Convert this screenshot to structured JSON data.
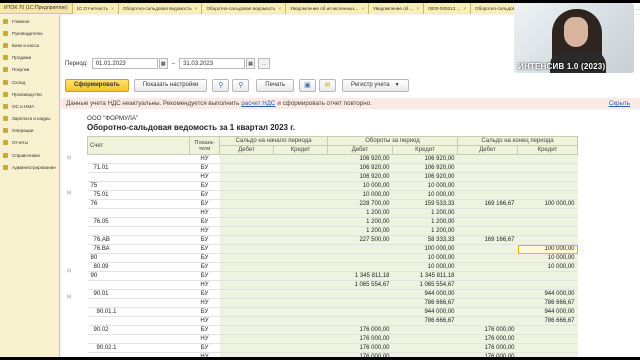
{
  "app": {
    "title": "ИТОК 70 (1С:Предприятие)"
  },
  "open_tabs": [
    "1С:Отчетность",
    "Оборотно-сальдовая ведомость",
    "Оборотно-сальдовая ведомость",
    "Уведомление об исчисленных...",
    "Уведомление об ...",
    "0000-000013 ...",
    "Оборотно-сальдовая ...",
    "Все начисления",
    "Оборотно-сальдовая ..."
  ],
  "sidebar": {
    "items": [
      {
        "label": "Главное",
        "icon": "home-icon"
      },
      {
        "label": "Руководителю",
        "icon": "chart-icon"
      },
      {
        "label": "Банк и касса",
        "icon": "bank-icon"
      },
      {
        "label": "Продажи",
        "icon": "cart-icon"
      },
      {
        "label": "Покупки",
        "icon": "bag-icon"
      },
      {
        "label": "Склад",
        "icon": "warehouse-icon"
      },
      {
        "label": "Производство",
        "icon": "factory-icon"
      },
      {
        "label": "ОС и НМА",
        "icon": "assets-icon"
      },
      {
        "label": "Зарплата и кадры",
        "icon": "people-icon"
      },
      {
        "label": "Операции",
        "icon": "operations-icon"
      },
      {
        "label": "Отчеты",
        "icon": "reports-icon"
      },
      {
        "label": "Справочники",
        "icon": "book-icon"
      },
      {
        "label": "Администрирование",
        "icon": "gear-icon"
      }
    ]
  },
  "document": {
    "title": "Оборотно-сальдовая ведомость за 1 квартал 2023 г."
  },
  "period": {
    "label": "Период:",
    "from": "01.01.2023",
    "separator": "–",
    "to": "31.03.2023",
    "more": "..."
  },
  "toolbar": {
    "generate": "Сформировать",
    "settings": "Показать настройки",
    "print": "Печать",
    "register": "Регистр учета"
  },
  "notice": {
    "text_before": "Данные учета НДС неактуальны. Рекомендуется выполнить",
    "link": "расчет НДС",
    "text_after": "и сформировать отчет повторно.",
    "hide": "Скрыть"
  },
  "report": {
    "organization": "ООО \"ФОРМУЛА\"",
    "title": "Оборотно-сальдовая ведомость за 1 квартал 2023 г.",
    "headers": {
      "account": "Счет",
      "indicators": "Показа-тели",
      "opening": "Сальдо на начало периода",
      "turnover": "Обороты за период",
      "closing": "Сальдо на конец периода",
      "debit": "Дебет",
      "credit": "Кредит"
    },
    "rows": [
      {
        "account": "",
        "type": "НУ",
        "od": "",
        "oc": "",
        "td": "106 920,00",
        "tc": "106 920,00",
        "cd": "",
        "cc": ""
      },
      {
        "account": "71.01",
        "type": "БУ",
        "od": "",
        "oc": "",
        "td": "106 920,00",
        "tc": "106 920,00",
        "cd": "",
        "cc": ""
      },
      {
        "account": "",
        "type": "НУ",
        "od": "",
        "oc": "",
        "td": "106 920,00",
        "tc": "106 920,00",
        "cd": "",
        "cc": ""
      },
      {
        "account": "75",
        "type": "БУ",
        "od": "",
        "oc": "",
        "td": "10 000,00",
        "tc": "10 000,00",
        "cd": "",
        "cc": ""
      },
      {
        "account": "75.01",
        "type": "БУ",
        "od": "",
        "oc": "",
        "td": "10 000,00",
        "tc": "10 000,00",
        "cd": "",
        "cc": ""
      },
      {
        "account": "76",
        "type": "БУ",
        "od": "",
        "oc": "",
        "td": "228 700,00",
        "tc": "159 533,33",
        "cd": "169 166,67",
        "cc": "100 000,00"
      },
      {
        "account": "",
        "type": "НУ",
        "od": "",
        "oc": "",
        "td": "1 200,00",
        "tc": "1 200,00",
        "cd": "",
        "cc": ""
      },
      {
        "account": "76.05",
        "type": "БУ",
        "od": "",
        "oc": "",
        "td": "1 200,00",
        "tc": "1 200,00",
        "cd": "",
        "cc": ""
      },
      {
        "account": "",
        "type": "НУ",
        "od": "",
        "oc": "",
        "td": "1 200,00",
        "tc": "1 200,00",
        "cd": "",
        "cc": ""
      },
      {
        "account": "76.АВ",
        "type": "БУ",
        "od": "",
        "oc": "",
        "td": "227 500,00",
        "tc": "58 333,33",
        "cd": "169 166,67",
        "cc": ""
      },
      {
        "account": "76.ВА",
        "type": "БУ",
        "od": "",
        "oc": "",
        "td": "",
        "tc": "100 000,00",
        "cd": "",
        "cc": "100 000,00",
        "sel": true
      },
      {
        "account": "80",
        "type": "БУ",
        "od": "",
        "oc": "",
        "td": "",
        "tc": "10 000,00",
        "cd": "",
        "cc": "10 000,00"
      },
      {
        "account": "80.09",
        "type": "БУ",
        "od": "",
        "oc": "",
        "td": "",
        "tc": "10 000,00",
        "cd": "",
        "cc": "10 000,00"
      },
      {
        "account": "90",
        "type": "БУ",
        "od": "",
        "oc": "",
        "td": "1 345 811,18",
        "tc": "1 345 811,18",
        "cd": "",
        "cc": ""
      },
      {
        "account": "",
        "type": "НУ",
        "od": "",
        "oc": "",
        "td": "1 065 554,67",
        "tc": "1 065 554,67",
        "cd": "",
        "cc": ""
      },
      {
        "account": "90.01",
        "type": "БУ",
        "od": "",
        "oc": "",
        "td": "",
        "tc": "944 000,00",
        "cd": "",
        "cc": "944 000,00"
      },
      {
        "account": "",
        "type": "НУ",
        "od": "",
        "oc": "",
        "td": "",
        "tc": "786 666,67",
        "cd": "",
        "cc": "786 666,67"
      },
      {
        "account": "90.01.1",
        "type": "БУ",
        "od": "",
        "oc": "",
        "td": "",
        "tc": "944 000,00",
        "cd": "",
        "cc": "944 000,00"
      },
      {
        "account": "",
        "type": "НУ",
        "od": "",
        "oc": "",
        "td": "",
        "tc": "786 666,67",
        "cd": "",
        "cc": "786 666,67"
      },
      {
        "account": "90.02",
        "type": "БУ",
        "od": "",
        "oc": "",
        "td": "176 000,00",
        "tc": "",
        "cd": "176 000,00",
        "cc": ""
      },
      {
        "account": "",
        "type": "НУ",
        "od": "",
        "oc": "",
        "td": "176 000,00",
        "tc": "",
        "cd": "176 000,00",
        "cc": ""
      },
      {
        "account": "90.02.1",
        "type": "БУ",
        "od": "",
        "oc": "",
        "td": "176 000,00",
        "tc": "",
        "cd": "176 000,00",
        "cc": ""
      },
      {
        "account": "",
        "type": "НУ",
        "od": "",
        "oc": "",
        "td": "176 000,00",
        "tc": "",
        "cd": "176 000,00",
        "cc": ""
      },
      {
        "account": "90.03",
        "type": "БУ",
        "od": "",
        "oc": "",
        "td": "157 333,33",
        "tc": "",
        "cd": "",
        "cc": "157 333,33"
      }
    ]
  },
  "webcam": {
    "caption": "ИНТЕНСИВ 1.0 (2023)"
  },
  "colors": {
    "accent": "#f2c42b",
    "titlebar": "#f6e7a6",
    "notice_bg": "#fbe9e4",
    "link": "#2d5fb4",
    "numeric_bg": "#edf3df"
  }
}
